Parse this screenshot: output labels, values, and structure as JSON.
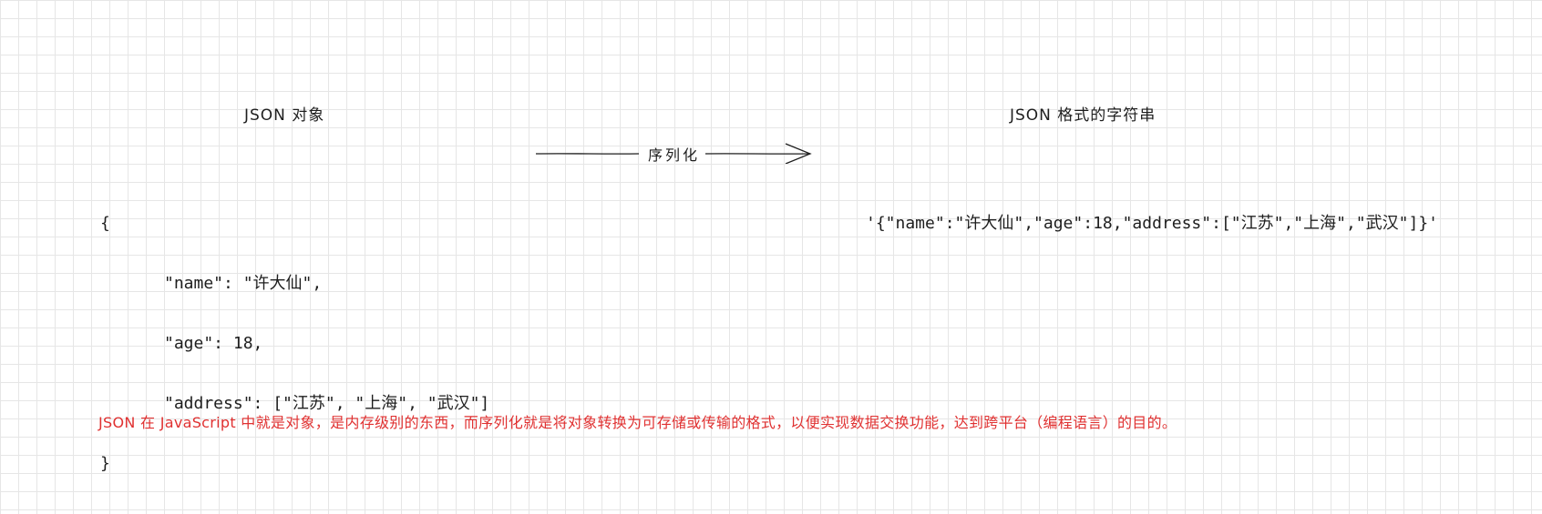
{
  "left": {
    "title": "JSON 对象",
    "code_lines": [
      "{",
      "\"name\": \"许大仙\",",
      "\"age\": 18,",
      "\"address\": [\"江苏\", \"上海\", \"武汉\"]",
      "}"
    ]
  },
  "arrow": {
    "label": "序列化"
  },
  "right": {
    "title": "JSON 格式的字符串",
    "string": "'{\"name\":\"许大仙\",\"age\":18,\"address\":[\"江苏\",\"上海\",\"武汉\"]}'"
  },
  "note": {
    "text": "JSON 在 JavaScript 中就是对象，是内存级别的东西，而序列化就是将对象转换为可存储或传输的格式，以便实现数据交换功能，达到跨平台（编程语言）的目的。",
    "color": "#e03131"
  },
  "colors": {
    "ink": "#1e1e1e",
    "grid": "#e6e6e6"
  }
}
